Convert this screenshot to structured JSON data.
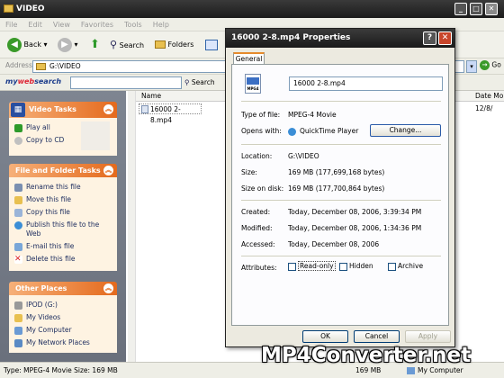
{
  "window": {
    "title": "VIDEO"
  },
  "menu": [
    "File",
    "Edit",
    "View",
    "Favorites",
    "Tools",
    "Help"
  ],
  "toolbar": {
    "back": "Back",
    "search": "Search",
    "folders": "Folders"
  },
  "address": {
    "label": "Address",
    "value": "G:\\VIDEO",
    "go": "Go"
  },
  "searchbar": {
    "brand_my": "my",
    "brand_web": "web",
    "brand_search": "search",
    "search_btn": "Search"
  },
  "tasks": {
    "video": {
      "title": "Video Tasks",
      "items": [
        "Play all",
        "Copy to CD"
      ]
    },
    "file": {
      "title": "File and Folder Tasks",
      "items": [
        "Rename this file",
        "Move this file",
        "Copy this file",
        "Publish this file to the Web",
        "E-mail this file",
        "Delete this file"
      ]
    },
    "other": {
      "title": "Other Places",
      "items": [
        "IPOD (G:)",
        "My Videos",
        "My Computer",
        "My Network Places"
      ]
    }
  },
  "filelist": {
    "col_name": "Name",
    "col_date": "Date Mo",
    "file_name": "16000 2-8.mp4",
    "file_date": "12/8/"
  },
  "status": {
    "left": "Type: MPEG-4 Movie Size: 169 MB",
    "size": "169 MB",
    "location": "My Computer"
  },
  "dialog": {
    "title": "16000 2-8.mp4 Properties",
    "tab": "General",
    "icon_text": "MPG4",
    "filename": "16000 2-8.mp4",
    "type_label": "Type of file:",
    "type_value": "MPEG-4 Movie",
    "opens_label": "Opens with:",
    "opens_value": "QuickTime Player",
    "change_btn": "Change...",
    "location_label": "Location:",
    "location_value": "G:\\VIDEO",
    "size_label": "Size:",
    "size_value": "169 MB (177,699,168 bytes)",
    "disk_label": "Size on disk:",
    "disk_value": "169 MB (177,700,864 bytes)",
    "created_label": "Created:",
    "created_value": "Today, December 08, 2006, 3:39:34 PM",
    "modified_label": "Modified:",
    "modified_value": "Today, December 08, 2006, 1:34:36 PM",
    "accessed_label": "Accessed:",
    "accessed_value": "Today, December 08, 2006",
    "attr_label": "Attributes:",
    "readonly": "Read-only",
    "hidden": "Hidden",
    "archive": "Archive",
    "ok": "OK",
    "cancel": "Cancel",
    "apply": "Apply"
  },
  "watermark": "MP4Converter.net"
}
